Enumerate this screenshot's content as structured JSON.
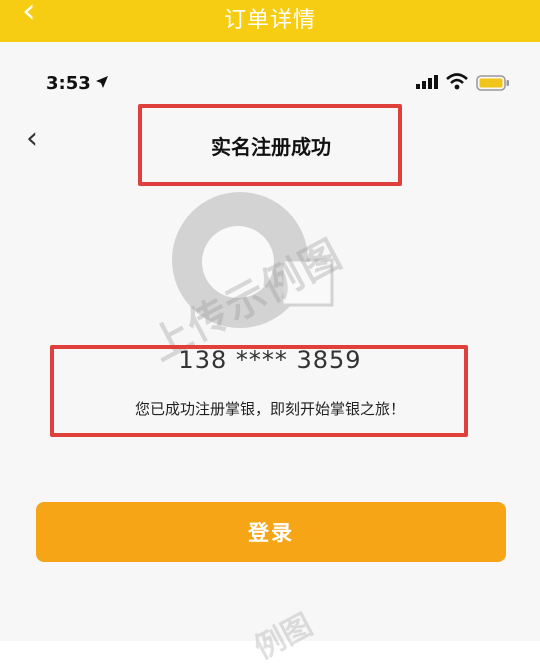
{
  "header": {
    "back_icon": "chevron-left-icon",
    "title": "订单详情"
  },
  "status_bar": {
    "time": "3:53"
  },
  "nav": {
    "back_icon": "chevron-left-icon",
    "title": "实名注册成功"
  },
  "info": {
    "phone": "138 **** 3859",
    "message": "您已成功注册掌银，即刻开始掌银之旅！"
  },
  "buttons": {
    "login_label": "登录"
  },
  "watermark": {
    "text": "上传示例图",
    "text2": "例图"
  },
  "colors": {
    "header": "#f7cd13",
    "button": "#f6a517",
    "highlight": "#e0403c"
  }
}
